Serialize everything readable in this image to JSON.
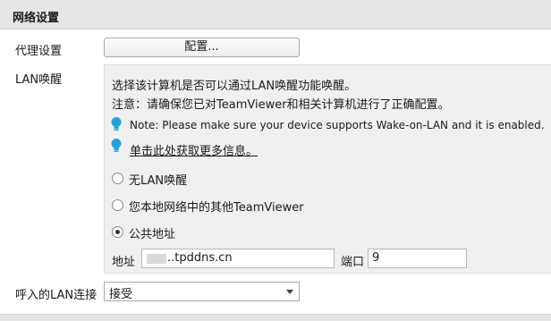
{
  "section": {
    "title": "网络设置"
  },
  "proxy": {
    "label": "代理设置",
    "button_label": "配置..."
  },
  "lan_wake": {
    "label": "LAN唤醒",
    "description": "选择该计算机是否可以通过LAN唤醒功能唤醒。",
    "warning": "注意：请确保您已对TeamViewer和相关计算机进行了正确配置。",
    "note": "Note: Please make sure your device supports Wake-on-LAN and it is enabled.",
    "more_info_link": "单击此处获取更多信息。",
    "options": [
      {
        "label": "无LAN唤醒",
        "selected": false
      },
      {
        "label": "您本地网络中的其他TeamViewer",
        "selected": false
      },
      {
        "label": "公共地址",
        "selected": true
      }
    ],
    "address_label": "地址",
    "address_value": "..tpddns.cn",
    "port_label": "端口",
    "port_value": "9"
  },
  "incoming_lan": {
    "label": "呼入的LAN连接",
    "selected": "接受"
  },
  "colors": {
    "bulb": "#1fa3e0",
    "header_bg": "#e6e6e6",
    "panel_bg": "#f0f0f0"
  },
  "icons": {
    "bulb": "lightbulb-icon",
    "dropdown": "chevron-down-icon"
  }
}
